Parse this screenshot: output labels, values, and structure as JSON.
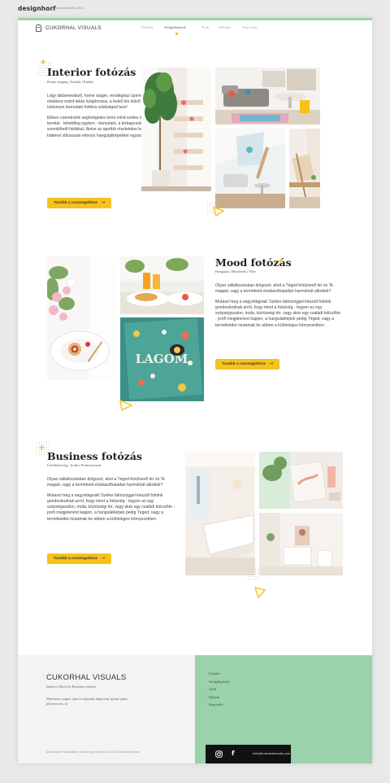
{
  "portfolio": {
    "brand": "designhorf",
    "caption": "Art Cukor-tervezet | 2019"
  },
  "site": {
    "logo_text": "CUKORHAL VISUALS",
    "nav": [
      {
        "label": "Főoldal",
        "active": false
      },
      {
        "label": "Szolgáltatások",
        "active": true
      },
      {
        "label": "Árak",
        "active": false
      },
      {
        "label": "Rólunk",
        "active": false
      },
      {
        "label": "Kapcsolat",
        "active": false
      }
    ]
  },
  "sections": [
    {
      "title": "Interior fotózás",
      "subtitle": "Home staging | Kiadás | Eladás",
      "paragraphs": [
        "Légy lakberendező, home stager, vendéghaz üzemeltető, vagy egy eladásra szánt lakás tulajdonosa, a belső tés külső tereket profin, ízlésesen bemutató fotókra szükséged lesz!",
        "Ebben szeretnénk segítségedre lenni mind széles látószögű, a tereket - lehetőleg egyben - bemutató, a térkapcsolatokat jól szemléltető fotókkal, illetve az apróbb részletekre koncentráló, a hátteret stílusosan elmosó hangulatképekkel egyaránt."
      ],
      "cta": "Tovább a csomagokhoz"
    },
    {
      "title": "Mood fotózás",
      "subtitle": "Hangulat | Részletek | Vibe",
      "paragraphs": [
        "Olyan vállalkozásban dolgozol, ahol a Téged körülvevő tér és Te magad, vagy a termékeid elválaszthatatlan harmóniát alkottok?",
        "Mutasd meg a nagyvilágnak! Széles látószöggel készült fotóink gondoskodnak arról, hogy mind a helyiség - legyen az egy szépségszalon, iroda, közösségi tér, vagy akár egy családi bölcsőde - profi megjelenést kapjon, a hangulatképek pedig Téged, vagy a termékeidet mutatnak be ebben a különleges környezetben."
      ],
      "cta": "Tovább a csomagokhoz"
    },
    {
      "title": "Business fotózás",
      "subtitle": "Üzlethelyiség | Iroda | Professzional",
      "paragraphs": [
        "Olyan vállalkozásban dolgozol, ahol a Téged körülvevő tér és Te magad, vagy a termékeid elválaszthatatlan harmóniát alkottok?",
        "Mutasd meg a nagyvilágnak! Széles látószöggel készült fotóink gondoskodnak arról, hogy mind a helyiség - legyen az egy szépségszalon, iroda, közösségi tér, vagy akár egy családi bölcsőde - profi megjelenést kapjon, a hangulatképek pedig Téged, vagy a termékeidet mutatnak be ebben a különleges környezetben."
      ],
      "cta": "Tovább a csomagokhoz"
    }
  ],
  "footer": {
    "logo_text": "CUKORHAL VISUALS",
    "tagline": "Interior, Mood és Business fotózás",
    "description": "Maecenas congue, ante et vulputate dignissim, ipsum quam placerat erat, in",
    "copyright": "Adatvédelmi Tájékoztató | Minden jog fenntartva © 2019 Cukorhal Visuals",
    "links": [
      "Főoldal",
      "Szolgáltatások",
      "Árak",
      "Rólunk",
      "Kapcsolat"
    ],
    "email": "hello@cukorhalvisuals.com",
    "social_icons": [
      "instagram-icon",
      "facebook-icon"
    ]
  },
  "colors": {
    "accent": "#f6c21b",
    "green": "#9bd1ab",
    "dark": "#111111"
  }
}
